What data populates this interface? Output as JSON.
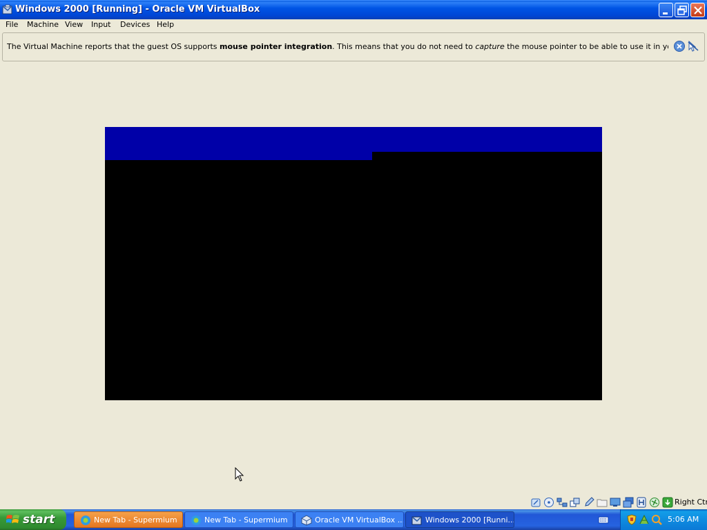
{
  "window": {
    "title": "Windows 2000 [Running] - Oracle VM VirtualBox",
    "app_icon": "virtualbox-icon"
  },
  "menubar": {
    "items": [
      "File",
      "Machine",
      "View",
      "Input",
      "Devices",
      "Help"
    ]
  },
  "notification": {
    "text_1": "The Virtual Machine reports that the guest OS supports ",
    "bold": "mouse pointer integration",
    "text_2": ". This means that you do not need to ",
    "italic": "capture",
    "text_3": " the mouse pointer to be able to use it in your guest OS -- all mouse",
    "buttons": [
      "close-icon",
      "mouse-integration-off-icon"
    ]
  },
  "vm_screen": {
    "colors": {
      "background": "#000000",
      "banner": "#0000A8"
    }
  },
  "statusbar": {
    "icons": [
      "hard-disk-icon",
      "optical-drive-icon",
      "network-icon",
      "usb-icon",
      "pencil-icon",
      "shared-folders-icon",
      "display-icon",
      "video-capture-icon",
      "vrde-icon",
      "mouse-integration-icon",
      "arrow-down-icon"
    ],
    "host_key": "Right Ctrl"
  },
  "taskbar": {
    "start_label": "start",
    "tasks": [
      {
        "label": "New Tab - Supermium",
        "icon": "supermium-icon"
      },
      {
        "label": "New Tab - Supermium",
        "icon": "supermium-icon"
      },
      {
        "label": "Oracle VM VirtualBox ...",
        "icon": "virtualbox-icon"
      },
      {
        "label": "Windows 2000 [Runni...",
        "icon": "virtualbox-icon"
      }
    ],
    "clock": "5:06 AM",
    "tray_icons": [
      "shield-icon",
      "network-tray-icon",
      "search-tray-icon"
    ]
  }
}
